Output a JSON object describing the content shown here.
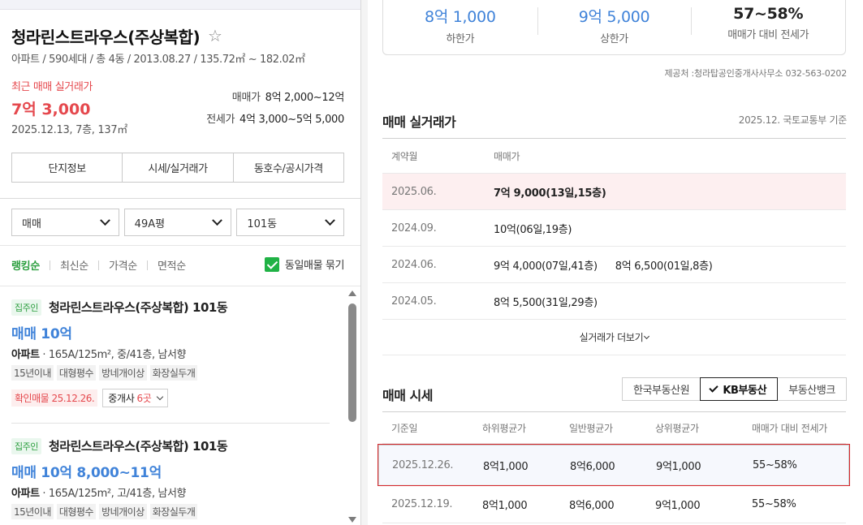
{
  "apartment": {
    "title": "청라린스트라우스(주상복합)",
    "summary": "아파트 / 590세대 / 총 4동 / 2013.08.27 / 135.72㎡ ~ 182.02㎡",
    "recent_label": "최근 매매 실거래가",
    "recent_price": "7억 3,000",
    "recent_date": "2025.12.13, 7층, 137㎡",
    "sale_range_key": "매매가",
    "sale_range": "8억 2,000~12억",
    "jeonse_range_key": "전세가",
    "jeonse_range": "4억 3,000~5억 5,000"
  },
  "detail_tabs": [
    "단지정보",
    "시세/실거래가",
    "동호수/공시가격"
  ],
  "filters": {
    "trade": "매매",
    "area": "49A평",
    "building": "101동"
  },
  "sort": {
    "items": [
      "랭킹순",
      "최신순",
      "가격순",
      "면적순"
    ],
    "group_label": "동일매물 묶기"
  },
  "listings": [
    {
      "badge": "집주인",
      "name": "청라린스트라우스(주상복합) 101동",
      "price": "매매 10억",
      "spec_type": "아파트",
      "spec": " · 165A/125m², 중/41층, 남서향",
      "tags": [
        "15년이내",
        "대형평수",
        "방네개이상",
        "화장실두개"
      ],
      "confirm": "확인매물 25.12.26.",
      "agent_prefix": "중개사 ",
      "agent_count": "6곳"
    },
    {
      "badge": "집주인",
      "name": "청라린스트라우스(주상복합) 101동",
      "price": "매매 10억 8,000~11억",
      "spec_type": "아파트",
      "spec": " · 165A/125m², 고/41층, 남서향",
      "tags": [
        "15년이내",
        "대형평수",
        "방네개이상",
        "화장실두개"
      ]
    }
  ],
  "stats": [
    {
      "value": "8억 1,000",
      "label": "하한가"
    },
    {
      "value": "9억 5,000",
      "label": "상한가"
    },
    {
      "value": "57~58%",
      "label": "매매가 대비 전세가"
    }
  ],
  "provider": "제공처 :청라탑공인중개사사무소 032-563-0202",
  "transactions": {
    "title": "매매 실거래가",
    "source": "2025.12. 국토교통부 기준",
    "headers": [
      "계약월",
      "매매가"
    ],
    "rows": [
      {
        "month": "2025.06.",
        "prices": [
          "7억 9,000(13일,15층)"
        ]
      },
      {
        "month": "2024.09.",
        "prices": [
          "10억(06일,19층)"
        ]
      },
      {
        "month": "2024.06.",
        "prices": [
          "9억 4,000(07일,41층)",
          "8억 6,500(01일,8층)"
        ]
      },
      {
        "month": "2024.05.",
        "prices": [
          "8억 5,500(31일,29층)"
        ]
      }
    ],
    "more_label": "실거래가 더보기"
  },
  "market": {
    "title": "매매 시세",
    "sources": [
      "한국부동산원",
      "KB부동산",
      "부동산뱅크"
    ],
    "active_source": "KB부동산",
    "headers": [
      "기준일",
      "하위평균가",
      "일반평균가",
      "상위평균가",
      "매매가 대비 전세가"
    ],
    "rows": [
      [
        "2025.12.26.",
        "8억1,000",
        "8억6,000",
        "9억1,000",
        "55~58%"
      ],
      [
        "2025.12.19.",
        "8억1,000",
        "8억6,000",
        "9억1,000",
        "55~58%"
      ]
    ]
  },
  "colors": {
    "accent_red": "#e5484d",
    "accent_blue": "#4083d9",
    "accent_green": "#2b9e3e",
    "selection_outline": "#d6262b"
  }
}
